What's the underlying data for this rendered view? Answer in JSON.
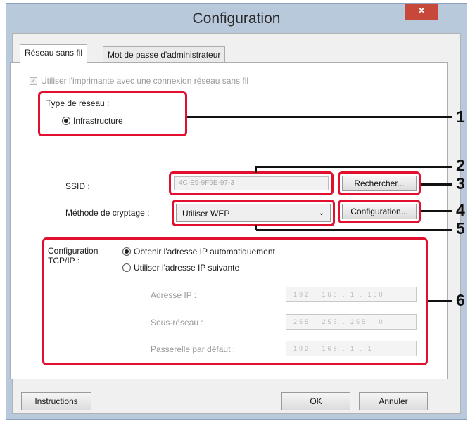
{
  "window": {
    "title": "Configuration",
    "close_label": "×"
  },
  "tabs": [
    "Réseau sans fil",
    "Mot de passe d'administrateur"
  ],
  "wireless": {
    "use_wireless_label": "Utiliser l'imprimante avec une connexion réseau sans fil",
    "use_wireless_checked": true,
    "network_type_label": "Type de réseau :",
    "infrastructure_label": "Infrastructure",
    "ssid_label": "SSID :",
    "ssid_value": "4C-E9-9F9E-97-3",
    "search_button": "Rechercher...",
    "encryption_label": "Méthode de cryptage :",
    "encryption_value": "Utiliser WEP",
    "config_button": "Configuration...",
    "tcpip_label": "Configuration TCP/IP :",
    "auto_ip_label": "Obtenir l'adresse IP automatiquement",
    "manual_ip_label": "Utiliser l'adresse IP suivante",
    "ip_address_label": "Adresse IP :",
    "ip_address_value": "192 . 168 . 1 . 100",
    "subnet_label": "Sous-réseau :",
    "subnet_value": "255 . 255 . 255 . 0",
    "gateway_label": "Passerelle par défaut :",
    "gateway_value": "192 . 168 . 1 . 1"
  },
  "footer": {
    "instructions": "Instructions",
    "ok": "OK",
    "cancel": "Annuler"
  },
  "callouts": [
    "1",
    "2",
    "3",
    "4",
    "5",
    "6"
  ],
  "colors": {
    "callout_red": "#e0102e",
    "titlebar": "#b9c9dc",
    "close": "#c7473a"
  }
}
